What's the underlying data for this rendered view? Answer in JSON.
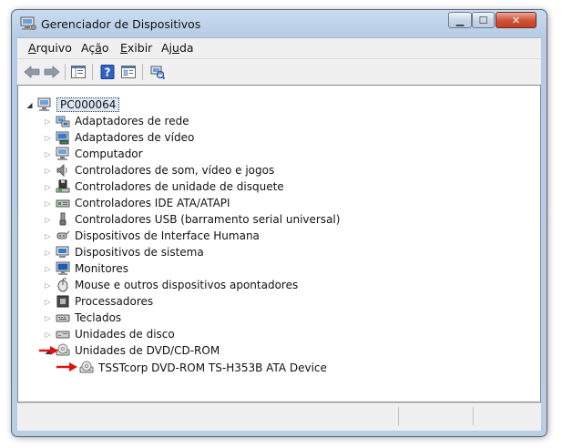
{
  "window": {
    "title": "Gerenciador de Dispositivos"
  },
  "controls": {
    "minimize": "▁",
    "maximize": "☐",
    "close": "✕"
  },
  "menu": [
    {
      "label": "Arquivo",
      "accel": "A",
      "rest": "rquivo"
    },
    {
      "label": "Ação",
      "pre": "Aç",
      "accel": "ã",
      "rest": "o"
    },
    {
      "label": "Exibir",
      "accel": "E",
      "rest": "xibir"
    },
    {
      "label": "Ajuda",
      "pre": "Aj",
      "accel": "u",
      "rest": "da"
    }
  ],
  "toolbar": {
    "buttons": [
      "back-icon",
      "forward-icon",
      "properties-icon",
      "help-icon",
      "view-icon",
      "scan-hardware-icon"
    ]
  },
  "tree": {
    "root": "PC000064",
    "categories": [
      {
        "label": "Adaptadores de rede",
        "icon": "network-adapter-icon",
        "expanded": false
      },
      {
        "label": "Adaptadores de vídeo",
        "icon": "display-adapter-icon",
        "expanded": false
      },
      {
        "label": "Computador",
        "icon": "computer-icon",
        "expanded": false
      },
      {
        "label": "Controladores de som, vídeo e jogos",
        "icon": "sound-icon",
        "expanded": false
      },
      {
        "label": "Controladores de unidade de disquete",
        "icon": "floppy-controller-icon",
        "expanded": false
      },
      {
        "label": "Controladores IDE ATA/ATAPI",
        "icon": "ide-controller-icon",
        "expanded": false
      },
      {
        "label": "Controladores USB (barramento serial universal)",
        "icon": "usb-icon",
        "expanded": false
      },
      {
        "label": "Dispositivos de Interface Humana",
        "icon": "hid-icon",
        "expanded": false
      },
      {
        "label": "Dispositivos de sistema",
        "icon": "system-device-icon",
        "expanded": false
      },
      {
        "label": "Monitores",
        "icon": "monitor-icon",
        "expanded": false
      },
      {
        "label": "Mouse e outros dispositivos apontadores",
        "icon": "mouse-icon",
        "expanded": false
      },
      {
        "label": "Processadores",
        "icon": "processor-icon",
        "expanded": false
      },
      {
        "label": "Teclados",
        "icon": "keyboard-icon",
        "expanded": false
      },
      {
        "label": "Unidades de disco",
        "icon": "disk-drive-icon",
        "expanded": false
      },
      {
        "label": "Unidades de DVD/CD-ROM",
        "icon": "dvd-drive-icon",
        "expanded": true
      }
    ],
    "child": {
      "label": "TSSTcorp DVD-ROM TS-H353B ATA Device",
      "icon": "dvd-drive-icon"
    }
  },
  "colors": {
    "accent_arrow": "#e01010",
    "titlebar": "#c9dcf0",
    "close_button": "#c94a30"
  }
}
